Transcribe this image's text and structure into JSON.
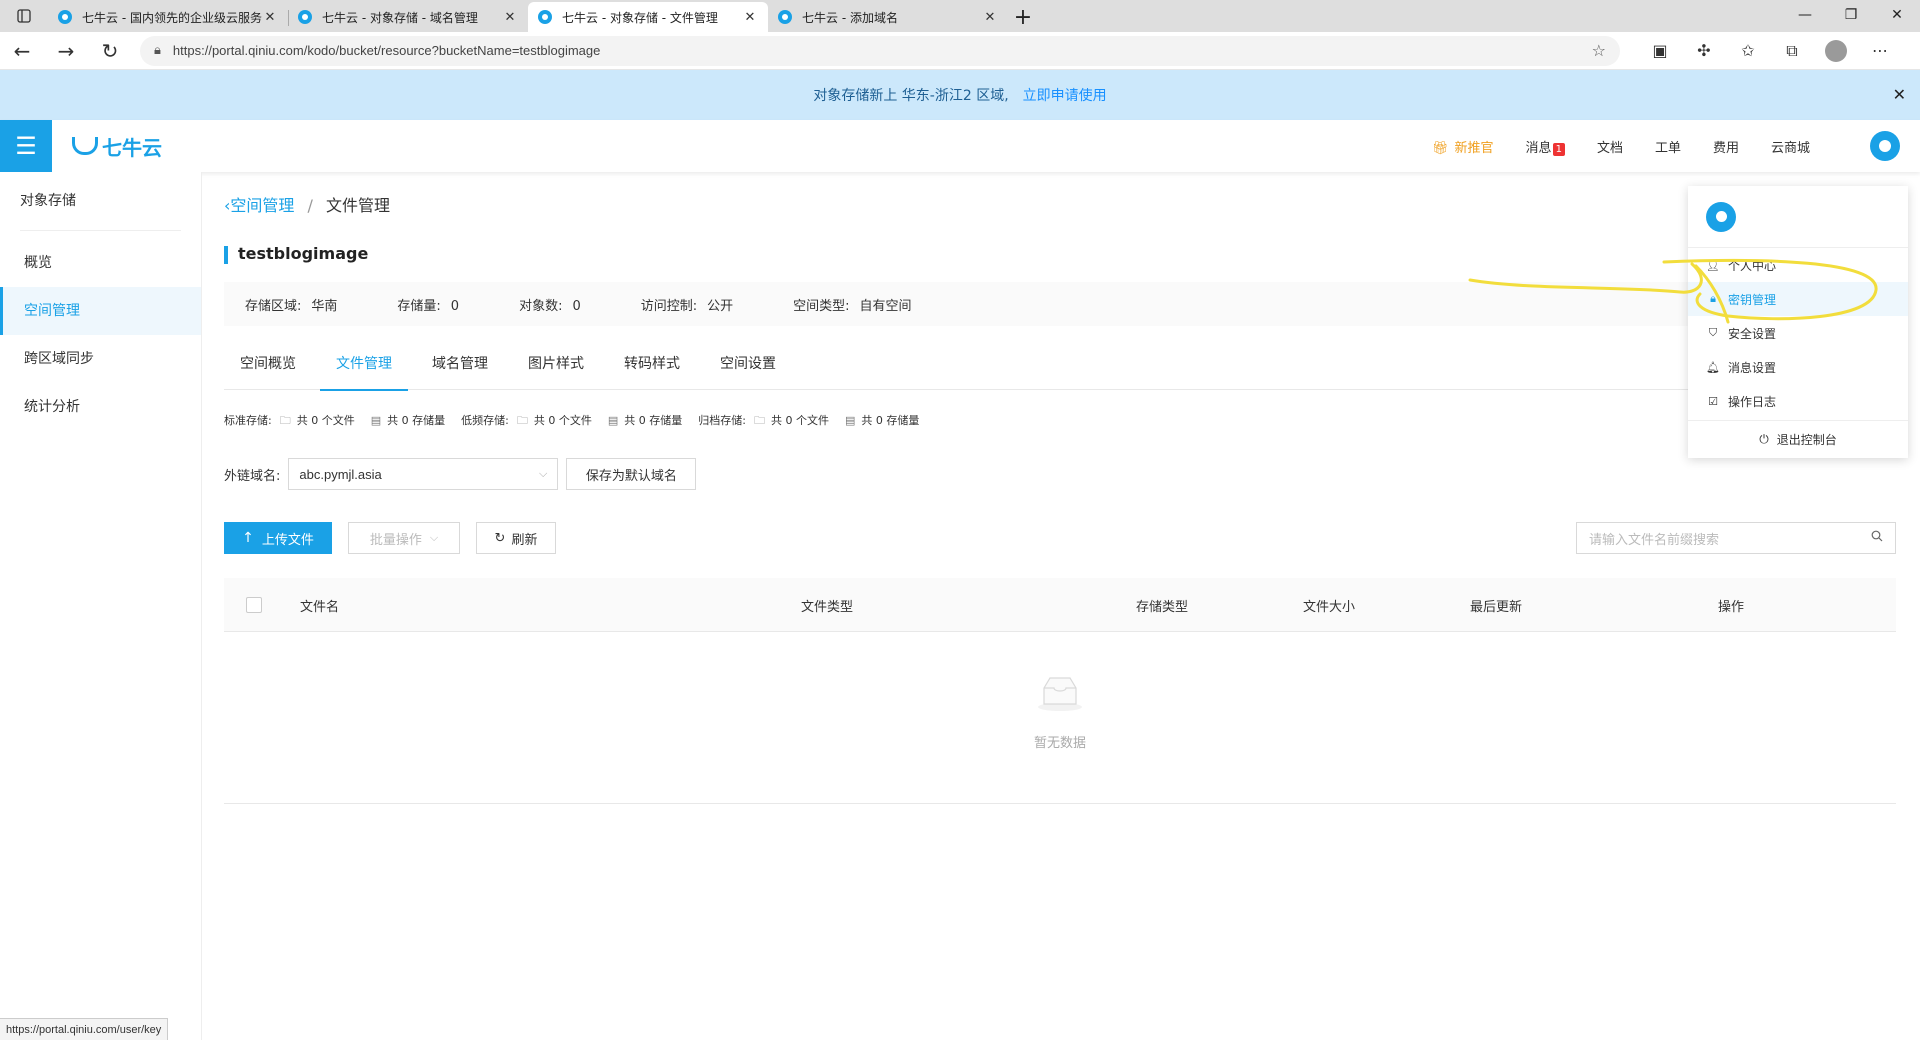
{
  "browser": {
    "tabs": [
      {
        "title": "七牛云 - 国内领先的企业级云服务"
      },
      {
        "title": "七牛云 - 对象存储 - 域名管理"
      },
      {
        "title": "七牛云 - 对象存储 - 文件管理"
      },
      {
        "title": "七牛云 - 添加域名"
      }
    ],
    "url": "https://portal.qiniu.com/kodo/bucket/resource?bucketName=testblogimage",
    "status_url": "https://portal.qiniu.com/user/key"
  },
  "announcement": {
    "text": "对象存储新上 华东-浙江2 区域,",
    "link": "立即申请使用"
  },
  "header": {
    "logo_text": "七牛云",
    "nav": {
      "promo": "新推官",
      "messages": "消息",
      "messages_count": "1",
      "docs": "文档",
      "tickets": "工单",
      "billing": "费用",
      "market": "云商城"
    }
  },
  "sidebar": {
    "title": "对象存储",
    "items": [
      {
        "label": "概览"
      },
      {
        "label": "空间管理"
      },
      {
        "label": "跨区域同步"
      },
      {
        "label": "统计分析"
      }
    ]
  },
  "breadcrumb": {
    "parent": "空间管理",
    "current": "文件管理"
  },
  "bucket": {
    "name": "testblogimage",
    "region_label": "存储区域:",
    "region": "华南",
    "storage_label": "存储量:",
    "storage": "0",
    "objects_label": "对象数:",
    "objects": "0",
    "access_label": "访问控制:",
    "access": "公开",
    "type_label": "空间类型:",
    "type": "自有空间"
  },
  "tabs": [
    {
      "label": "空间概览"
    },
    {
      "label": "文件管理"
    },
    {
      "label": "域名管理"
    },
    {
      "label": "图片样式"
    },
    {
      "label": "转码样式"
    },
    {
      "label": "空间设置"
    }
  ],
  "storage_summary": [
    {
      "label": "标准存储:",
      "files": "共 0 个文件",
      "size": "共 0 存储量"
    },
    {
      "label": "低频存储:",
      "files": "共 0 个文件",
      "size": "共 0 存储量"
    },
    {
      "label": "归档存储:",
      "files": "共 0 个文件",
      "size": "共 0 存储量"
    }
  ],
  "domain": {
    "label": "外链域名:",
    "value": "abc.pymjl.asia",
    "save_default": "保存为默认域名"
  },
  "actions": {
    "upload": "上传文件",
    "batch": "批量操作",
    "refresh": "刷新",
    "search_placeholder": "请输入文件名前缀搜索"
  },
  "table": {
    "columns": [
      "文件名",
      "文件类型",
      "存储类型",
      "文件大小",
      "最后更新",
      "操作"
    ],
    "empty_text": "暂无数据"
  },
  "user_menu": {
    "items": [
      {
        "label": "个人中心"
      },
      {
        "label": "密钥管理"
      },
      {
        "label": "安全设置"
      },
      {
        "label": "消息设置"
      },
      {
        "label": "操作日志"
      }
    ],
    "logout": "退出控制台"
  },
  "colors": {
    "brand": "#1aa1e6",
    "announce_bg": "#cce8fb",
    "annotation": "#f2dd3c"
  }
}
